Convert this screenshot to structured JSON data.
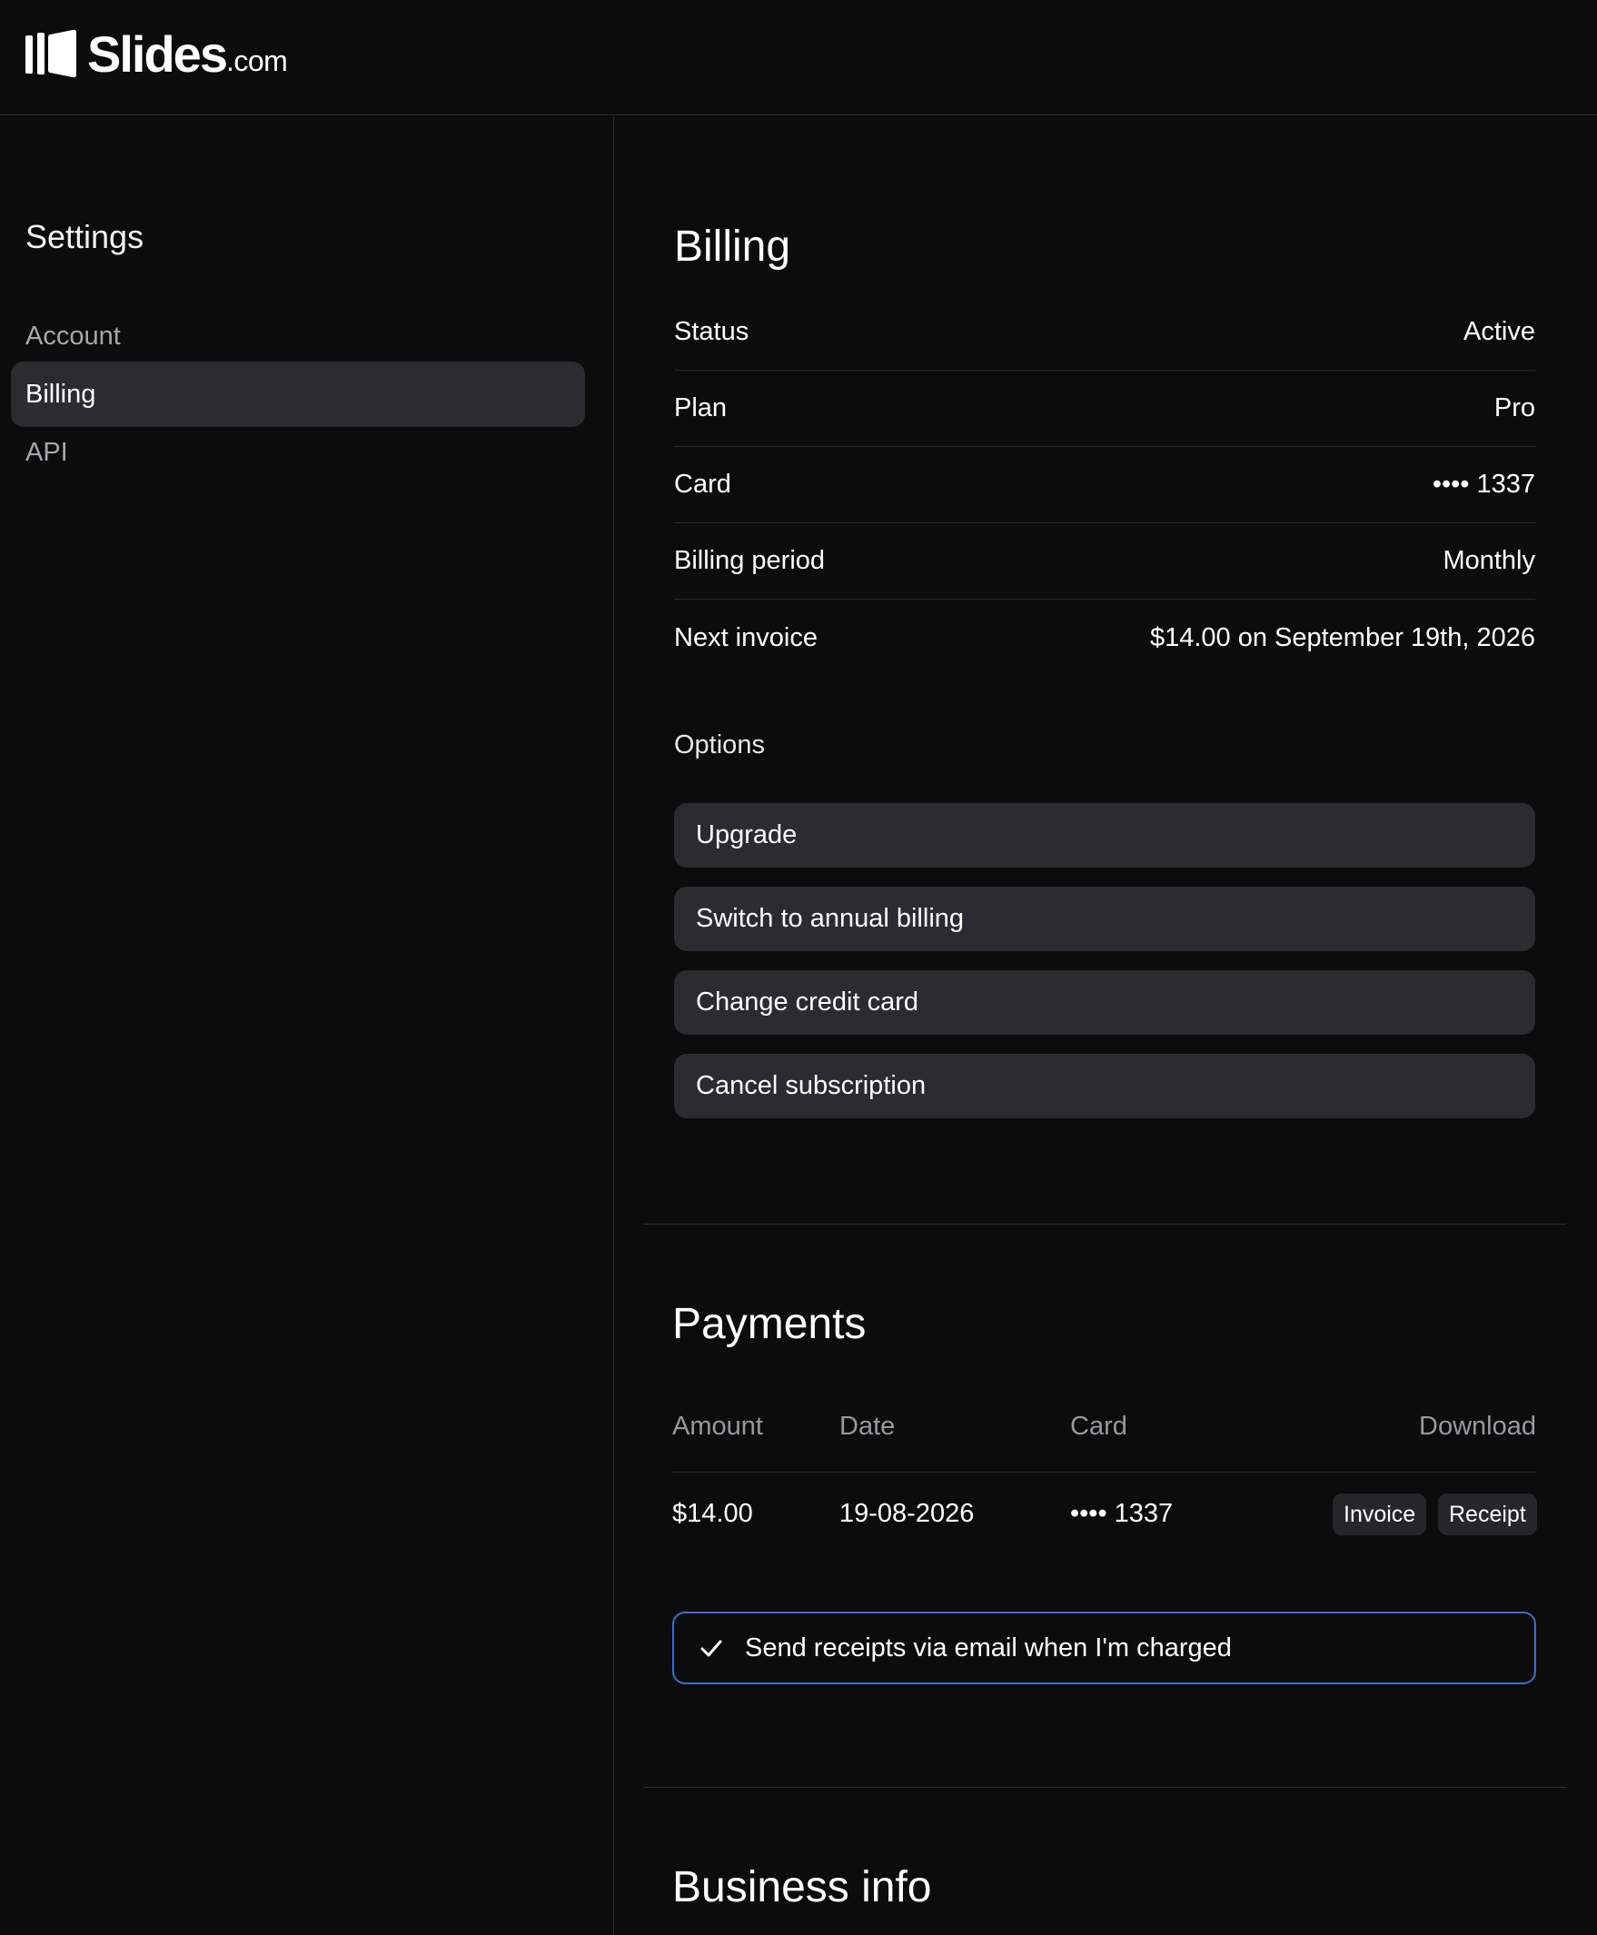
{
  "header": {
    "brand_name": "Slides",
    "brand_tld": ".com"
  },
  "sidebar": {
    "title": "Settings",
    "items": [
      {
        "label": "Account",
        "active": false
      },
      {
        "label": "Billing",
        "active": true
      },
      {
        "label": "API",
        "active": false
      }
    ]
  },
  "billing": {
    "title": "Billing",
    "rows": [
      {
        "label": "Status",
        "value": "Active"
      },
      {
        "label": "Plan",
        "value": "Pro"
      },
      {
        "label": "Card",
        "value": "•••• 1337"
      },
      {
        "label": "Billing period",
        "value": "Monthly"
      },
      {
        "label": "Next invoice",
        "value": "$14.00 on September 19th, 2026"
      }
    ],
    "options_label": "Options",
    "options": [
      {
        "label": "Upgrade"
      },
      {
        "label": "Switch to annual billing"
      },
      {
        "label": "Change credit card"
      },
      {
        "label": "Cancel subscription"
      }
    ]
  },
  "payments": {
    "title": "Payments",
    "columns": [
      "Amount",
      "Date",
      "Card",
      "Download"
    ],
    "rows": [
      {
        "amount": "$14.00",
        "date": "19-08-2026",
        "card": "•••• 1337",
        "invoice_label": "Invoice",
        "receipt_label": "Receipt"
      }
    ],
    "email_receipts": {
      "label": "Send receipts via email when I'm charged",
      "checked": true
    }
  },
  "business": {
    "title": "Business info"
  },
  "colors": {
    "background": "#0c0c0d",
    "surface": "#2b2b30",
    "focus_border": "#3b6fd1"
  }
}
